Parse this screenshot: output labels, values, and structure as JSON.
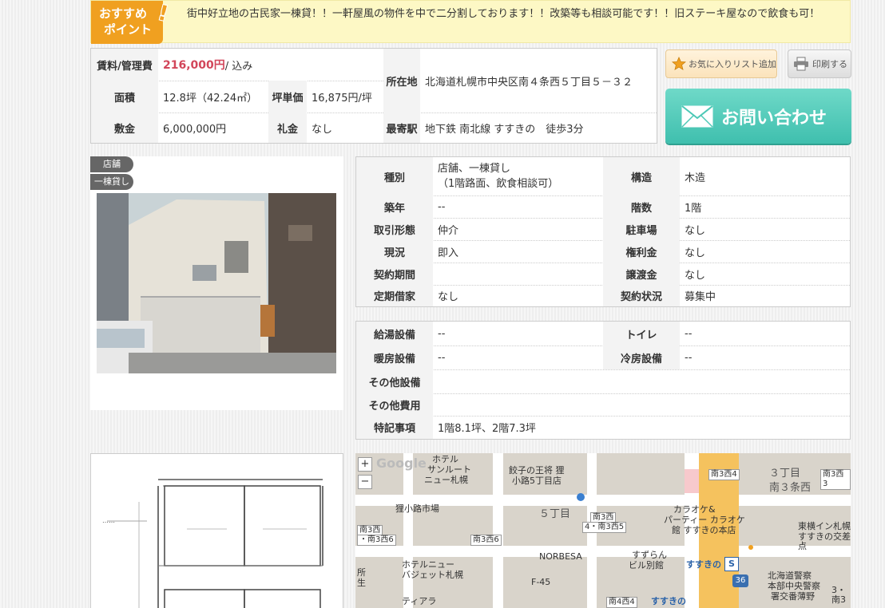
{
  "recommend": {
    "badge_line1": "おすすめ",
    "badge_line2": "ポイント",
    "text": "街中好立地の古民家一棟貸！！一軒屋風の物件を中で二分割しております！！改築等も相談可能です！！旧ステーキ屋なので飲食も可！"
  },
  "summary": {
    "rent_label": "賃料/管理費",
    "rent_value": "216,000円",
    "rent_suffix": " / 込み",
    "area_label": "面積",
    "area_value": "12.8坪（42.24㎡）",
    "unit_price_label": "坪単価",
    "unit_price_value": "16,875円/坪",
    "deposit_label": "敷金",
    "deposit_value": "6,000,000円",
    "key_money_label": "礼金",
    "key_money_value": "なし",
    "address_label": "所在地",
    "address_value": "北海道札幌市中央区南４条西５丁目５－３２",
    "station_label": "最寄駅",
    "station_value": "地下鉄 南北線 すすきの　徒歩3分"
  },
  "buttons": {
    "favorite": "お気に入りリスト追加",
    "print": "印刷する",
    "contact": "お問い合わせ"
  },
  "tags": [
    "店舗",
    "一棟貸し"
  ],
  "detail": {
    "type_label": "種別",
    "type_value_1": "店舗、一棟貸し",
    "type_value_2": "（1階路面、飲食相談可）",
    "structure_label": "構造",
    "structure_value": "木造",
    "built_label": "築年",
    "built_value": "--",
    "floors_label": "階数",
    "floors_value": "1階",
    "transaction_label": "取引形態",
    "transaction_value": "仲介",
    "parking_label": "駐車場",
    "parking_value": "なし",
    "status_label": "現況",
    "status_value": "即入",
    "premium_label": "権利金",
    "premium_value": "なし",
    "term_label": "契約期間",
    "term_value": "",
    "transfer_label": "譲渡金",
    "transfer_value": "なし",
    "fixed_lease_label": "定期借家",
    "fixed_lease_value": "なし",
    "contract_status_label": "契約状況",
    "contract_status_value": "募集中"
  },
  "facilities": {
    "water_label": "給湯設備",
    "water_value": "--",
    "toilet_label": "トイレ",
    "toilet_value": "--",
    "heating_label": "暖房設備",
    "heating_value": "--",
    "cooling_label": "冷房設備",
    "cooling_value": "--",
    "other_equip_label": "その他設備",
    "other_equip_value": "",
    "other_cost_label": "その他費用",
    "other_cost_value": "",
    "notes_label": "特記事項",
    "notes_value": "1階8.1坪、2階7.3坪"
  },
  "map": {
    "zoom_in": "+",
    "zoom_out": "−",
    "google": "Google",
    "labels": {
      "hotel_sunroute_1": "ホテル",
      "hotel_sunroute_2": "サンルート",
      "hotel_sunroute_3": "ニュー札幌",
      "gyoza_1": "餃子の王将 狸",
      "gyoza_2": "小路5丁目店",
      "market": "狸小路市場",
      "chome5": "５丁目",
      "s3w4": "南3西4",
      "chome3": "３丁目",
      "s3w3": "南3西3",
      "s3w_label": "南３条西",
      "s3w5": "南3西",
      "s3w5b": "4・南3西5",
      "karaoke_1": "カラオケ&",
      "karaoke_2": "パーティー カラオケ",
      "karaoke_3": "館 すすきの本店",
      "s3w6": "南3西",
      "s3w6b": "・南3西6",
      "s3w6c": "南3西6",
      "norbesa": "NORBESA",
      "toyoko_1": "東横イン札幌",
      "toyoko_2": "すすきの交差点",
      "hotel_new_1": "ホテルニュー",
      "hotel_new_2": "バジェット札幌",
      "suzuran_1": "すずらん",
      "suzuran_2": "ビル別館",
      "susukino": "すすきの",
      "s_badge": "S",
      "route36": "36",
      "police_1": "北海道警察",
      "police_2": "本部中央警察",
      "police_3": "署交番薄野",
      "f45": "F-45",
      "s4w4": "南4西4",
      "susukino2": "すすきの",
      "tiara_1": "ティアラ",
      "chome3b": "3・南3",
      "side_1": "所",
      "side_2": "生"
    }
  },
  "colors": {
    "accent_orange": "#f0a020",
    "price_red": "#d2465a",
    "contact_teal": "#4cc8b6",
    "recommend_bg": "#fdf8c5"
  }
}
